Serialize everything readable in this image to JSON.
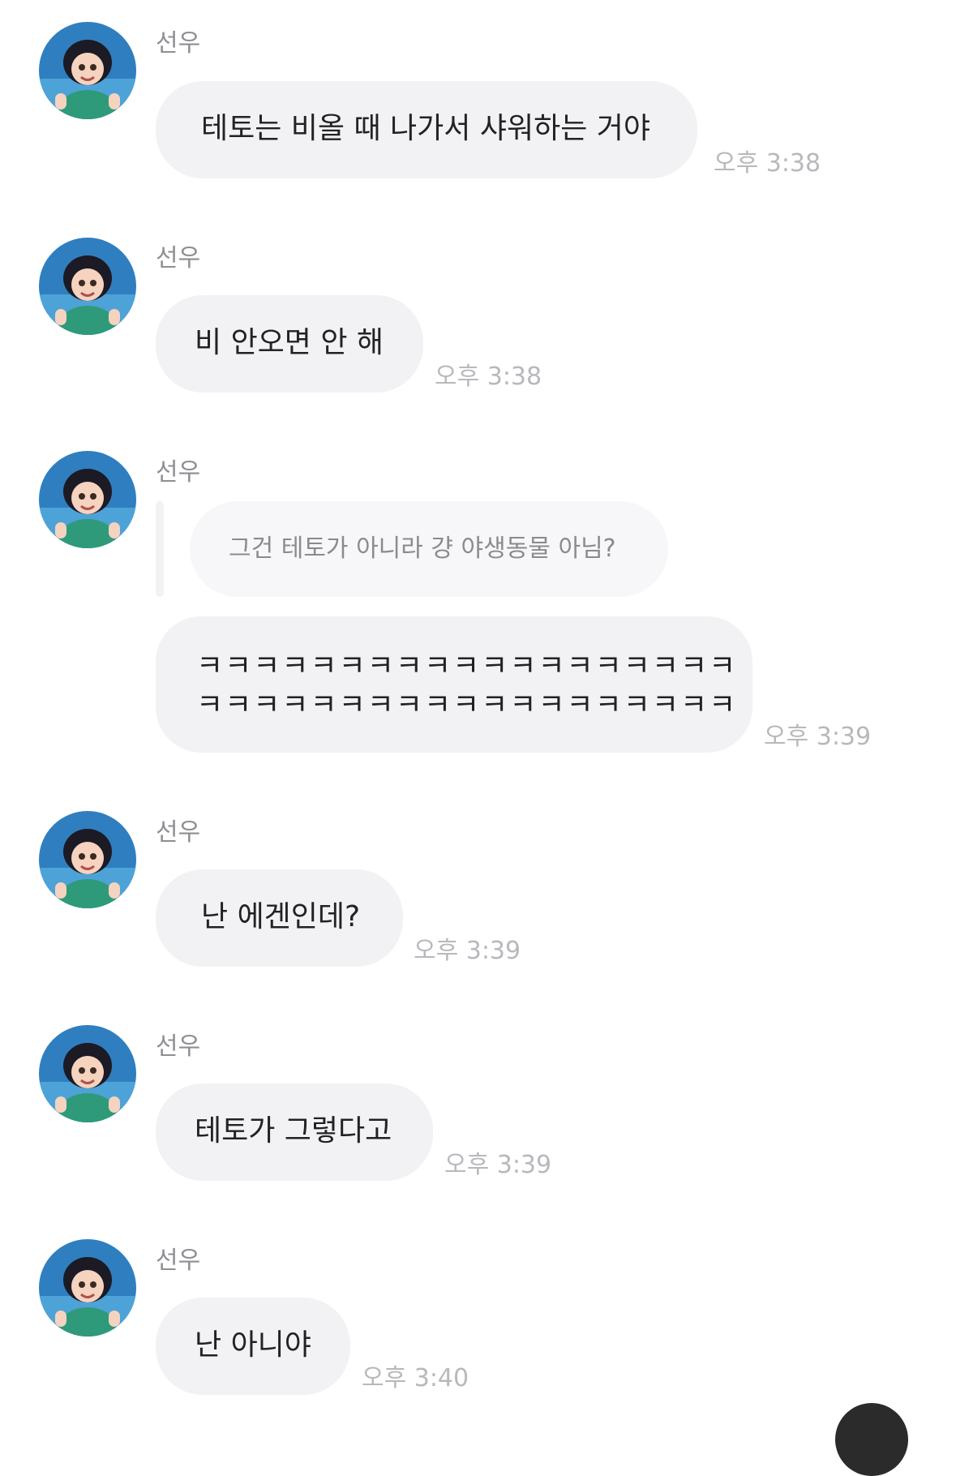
{
  "chat": {
    "messages": [
      {
        "sender": "선우",
        "text": "테토는 비올 때 나가서 샤워하는 거야",
        "time": "오후 3:38"
      },
      {
        "sender": "선우",
        "text": "비 안오면 안 해",
        "time": "오후 3:38"
      },
      {
        "sender": "선우",
        "quoted": "그건 테토가 아니라 걍 야생동물 아님?",
        "line1": "ㅋㅋㅋㅋㅋㅋㅋㅋㅋㅋㅋㅋㅋㅋㅋㅋㅋㅋㅋ",
        "line2": "ㅋㅋㅋㅋㅋㅋㅋㅋㅋㅋㅋㅋㅋㅋㅋㅋㅋㅋㅋ",
        "time": "오후 3:39"
      },
      {
        "sender": "선우",
        "text": "난 에겐인데?",
        "time": "오후 3:39"
      },
      {
        "sender": "선우",
        "text": "테토가 그렇다고",
        "time": "오후 3:39"
      },
      {
        "sender": "선우",
        "text": "난 아니야",
        "time": "오후 3:40"
      }
    ]
  },
  "avatar": {
    "icon": "cartoon-girl-avatar-icon",
    "colors": {
      "background": "#2f7fc0",
      "hoodie": "#2e9a7a",
      "hair": "#1c1a24",
      "skin": "#f6d3bf"
    }
  }
}
